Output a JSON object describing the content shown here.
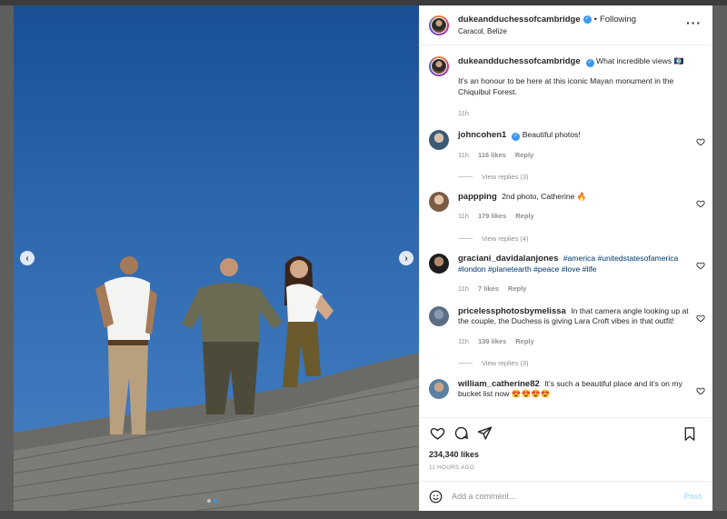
{
  "post": {
    "header": {
      "username": "dukeandduchessofcambridge",
      "separator": "•",
      "follow_status": "Following",
      "location": "Caracol, Belize"
    },
    "caption": {
      "username": "dukeandduchessofcambridge",
      "text_line": "What incredible views 🇧🇿",
      "body": "It’s an honour to be here at this iconic Mayan monument in the Chiquibul Forest.",
      "time": "11h"
    },
    "comments": [
      {
        "username": "johncohen1",
        "verified": true,
        "text": "Beautiful photos!",
        "time": "11h",
        "likes": "116 likes",
        "reply_label": "Reply",
        "view_replies": "View replies (3)"
      },
      {
        "username": "pappping",
        "verified": false,
        "text": "2nd photo, Catherine 🔥",
        "time": "11h",
        "likes": "179 likes",
        "reply_label": "Reply",
        "view_replies": "View replies (4)"
      },
      {
        "username": "graciani_davidalanjones",
        "verified": false,
        "hashtags": "#america #unitedstatesofamerica #london #planetearth #peace #love #life",
        "time": "11h",
        "likes": "7 likes",
        "reply_label": "Reply"
      },
      {
        "username": "pricelessphotosbymelissa",
        "verified": false,
        "text": "In that camera angle looking up at the couple, the Duchess is giving Lara Croft vibes in that outfit!",
        "time": "11h",
        "likes": "139 likes",
        "reply_label": "Reply",
        "view_replies": "View replies (3)"
      },
      {
        "username": "william_catherine82",
        "verified": false,
        "text": "It’s such a beautiful place and it’s on my bucket list now 😍😍😍😍"
      }
    ],
    "likes_count": "234,340 likes",
    "time_ago": "11 HOURS AGO",
    "add_comment_placeholder": "Add a comment...",
    "post_label": "Post",
    "carousel": {
      "total_slides": 2,
      "active_slide": 2
    }
  },
  "icons": {
    "prev": "chevron-left-icon",
    "next": "chevron-right-icon",
    "more": "more-options-icon",
    "like": "heart-icon",
    "comment": "comment-icon",
    "share": "share-icon",
    "save": "bookmark-icon",
    "emoji": "emoji-icon"
  },
  "colors": {
    "link": "#00376b",
    "verified": "#3897f0",
    "muted": "#8e8e8e",
    "post_button_disabled": "#b2dffc"
  }
}
